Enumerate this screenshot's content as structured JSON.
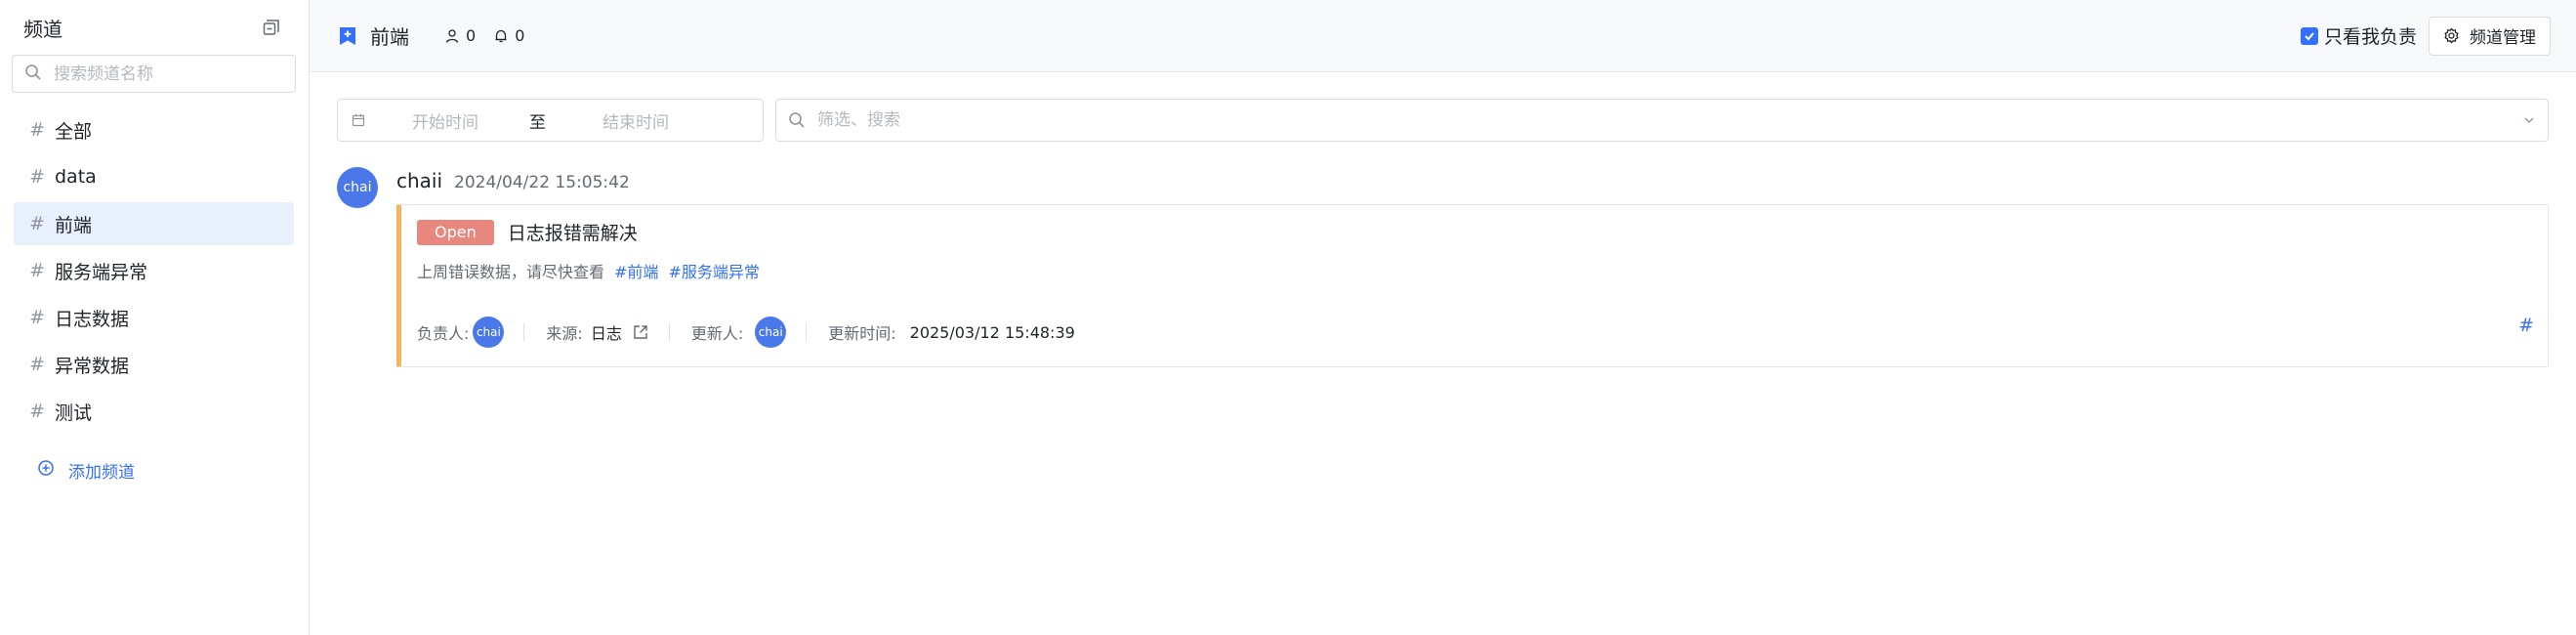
{
  "sidebar": {
    "title": "频道",
    "search_placeholder": "搜索频道名称",
    "items": [
      {
        "label": "全部"
      },
      {
        "label": "data"
      },
      {
        "label": "前端"
      },
      {
        "label": "服务端异常"
      },
      {
        "label": "日志数据"
      },
      {
        "label": "异常数据"
      },
      {
        "label": "测试"
      }
    ],
    "active_index": 2,
    "add_label": "添加频道"
  },
  "topbar": {
    "channel_title": "前端",
    "member_count": "0",
    "notify_count": "0",
    "only_mine_label": "只看我负责",
    "only_mine_checked": true,
    "manage_label": "频道管理"
  },
  "filters": {
    "start_placeholder": "开始时间",
    "to_label": "至",
    "end_placeholder": "结束时间",
    "search_placeholder": "筛选、搜索"
  },
  "message": {
    "avatar_text": "chai",
    "user": "chaii",
    "time": "2024/04/22 15:05:42",
    "card": {
      "status": "Open",
      "title": "日志报错需解决",
      "description": "上周错误数据，请尽快查看",
      "tags": [
        "#前端",
        "#服务端异常"
      ],
      "assignee_label": "负责人:",
      "assignee_avatar": "chai",
      "source_label": "来源:",
      "source_value": "日志",
      "updater_label": "更新人:",
      "updater_avatar": "chai",
      "updated_label": "更新时间:",
      "updated_value": "2025/03/12 15:48:39",
      "hash": "#"
    }
  },
  "colors": {
    "accent": "#3370ff",
    "open_tag": "#e8877d",
    "card_border_left": "#f5b55f",
    "active_item_bg": "#e8effd"
  }
}
